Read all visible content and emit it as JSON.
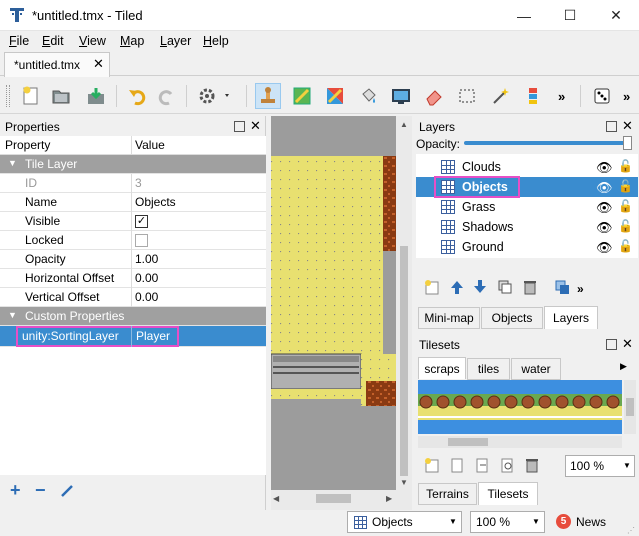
{
  "window": {
    "title": "*untitled.tmx - Tiled"
  },
  "menu": [
    {
      "label": "File",
      "u": "F",
      "rest": "ile"
    },
    {
      "label": "Edit",
      "u": "E",
      "rest": "dit"
    },
    {
      "label": "View",
      "u": "V",
      "rest": "iew"
    },
    {
      "label": "Map",
      "u": "M",
      "rest": "ap"
    },
    {
      "label": "Layer",
      "u": "L",
      "rest": "ayer"
    },
    {
      "label": "Help",
      "u": "H",
      "rest": "elp"
    }
  ],
  "doc_tab": {
    "label": "*untitled.tmx",
    "close": "✕"
  },
  "toolbar": {
    "overflow": "»",
    "icons": [
      "new-file",
      "open-file",
      "save-file",
      "undo",
      "redo",
      "command-gear",
      "stamp-brush",
      "terrain-brush",
      "wang-brush",
      "bucket-fill",
      "shape-fill",
      "eraser",
      "rectangle-select",
      "magic-wand",
      "select-same-tile",
      "random-dice"
    ]
  },
  "properties": {
    "title": "Properties",
    "col_property": "Property",
    "col_value": "Value",
    "group_tile_layer": "Tile Layer",
    "rows": [
      {
        "name": "ID",
        "value": "3"
      },
      {
        "name": "Name",
        "value": "Objects"
      },
      {
        "name": "Visible",
        "value": "✓"
      },
      {
        "name": "Locked",
        "value": ""
      },
      {
        "name": "Opacity",
        "value": "1.00"
      },
      {
        "name": "Horizontal Offset",
        "value": "0.00"
      },
      {
        "name": "Vertical Offset",
        "value": "0.00"
      }
    ],
    "group_custom": "Custom Properties",
    "custom": {
      "name": "unity:SortingLayer",
      "value": "Player"
    },
    "add": "+",
    "remove": "−"
  },
  "layers": {
    "title": "Layers",
    "opacity_label": "Opacity:",
    "opacity": 1.0,
    "items": [
      "Clouds",
      "Objects",
      "Grass",
      "Shadows",
      "Ground"
    ],
    "selected": "Objects",
    "tabs": [
      "Mini-map",
      "Objects",
      "Layers"
    ],
    "active_tab": "Layers"
  },
  "tilesets": {
    "title": "Tilesets",
    "tabs": [
      "scraps",
      "tiles",
      "water"
    ],
    "active_tab": "scraps",
    "zoom": "100 %",
    "bottom_tabs": [
      "Terrains",
      "Tilesets"
    ],
    "active_bottom_tab": "Tilesets"
  },
  "status": {
    "layer": "Objects",
    "zoom": "100 %",
    "news_count": "5",
    "news_label": "News"
  },
  "colors": {
    "accent": "#3a8ccf",
    "highlight": "#e64fc6",
    "map_yellow": "#e8e070"
  }
}
